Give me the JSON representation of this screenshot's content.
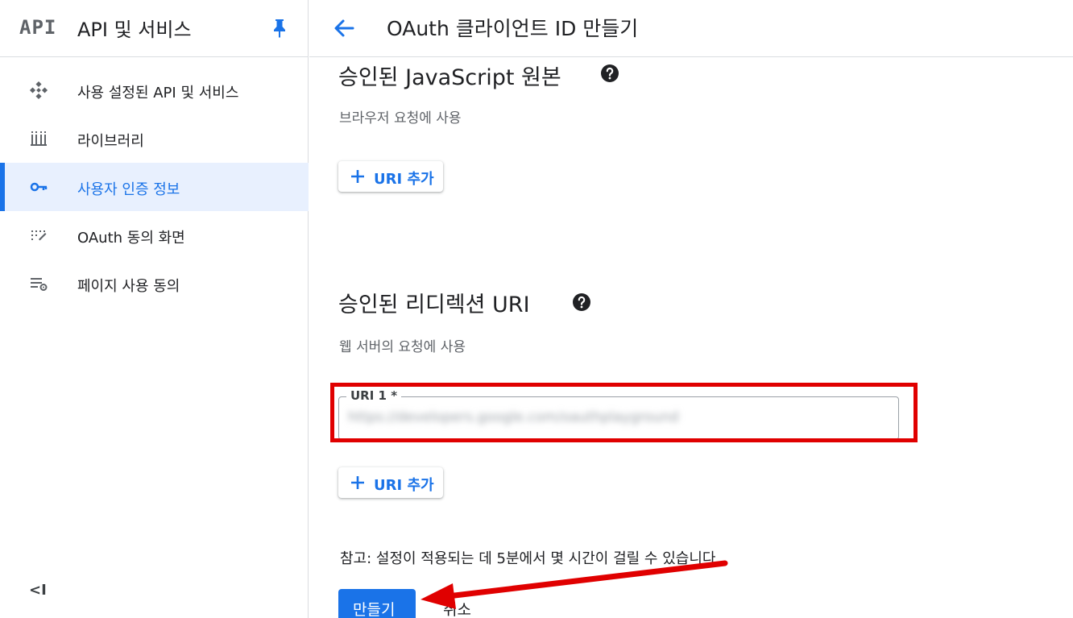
{
  "sidebar": {
    "logo": "API",
    "title": "API 및 서비스",
    "items": [
      {
        "label": "사용 설정된 API 및 서비스",
        "icon": "enabled-apis-icon"
      },
      {
        "label": "라이브러리",
        "icon": "library-icon"
      },
      {
        "label": "사용자 인증 정보",
        "icon": "key-icon",
        "active": true
      },
      {
        "label": "OAuth 동의 화면",
        "icon": "consent-screen-icon"
      },
      {
        "label": "페이지 사용 동의",
        "icon": "page-settings-icon"
      }
    ],
    "collapse_label": "<I"
  },
  "header": {
    "title": "OAuth 클라이언트 ID 만들기"
  },
  "main": {
    "js_origins": {
      "title": "승인된 JavaScript 원본",
      "subtitle": "브라우저 요청에 사용",
      "add_label": "URI 추가"
    },
    "redirect_uris": {
      "title": "승인된 리디렉션 URI",
      "subtitle": "웹 서버의 요청에 사용",
      "field_label": "URI 1 *",
      "field_value": "https://developers.google.com/oauthplayground",
      "add_label": "URI 추가"
    },
    "note": "참고: 설정이 적용되는 데 5분에서 몇 시간이 걸릴 수 있습니다.",
    "create_label": "만들기",
    "cancel_label": "취소"
  },
  "colors": {
    "accent": "#1a73e8",
    "highlight": "#e00000"
  }
}
